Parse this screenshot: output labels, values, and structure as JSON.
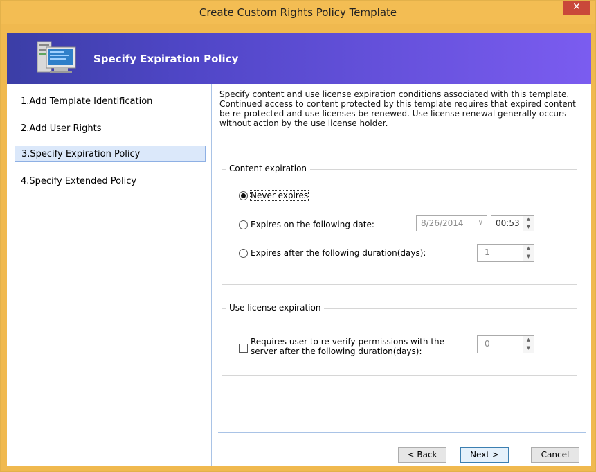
{
  "window": {
    "title": "Create Custom Rights Policy Template",
    "close_glyph": "✕"
  },
  "header": {
    "title": "Specify Expiration Policy",
    "icon": "computer-server-icon"
  },
  "steps": [
    {
      "label": "1.Add Template Identification"
    },
    {
      "label": "2.Add User Rights"
    },
    {
      "label": "3.Specify Expiration Policy"
    },
    {
      "label": "4.Specify Extended Policy"
    }
  ],
  "description": "Specify content and use license expiration conditions associated with this template. Continued access to content protected by this template requires that expired content be re-protected and use licenses be renewed. Use license renewal generally occurs without action by the use license holder.",
  "content_expiration": {
    "legend": "Content expiration",
    "never_label": "Never expires",
    "date_label": "Expires on the following date:",
    "date_value": "8/26/2014",
    "time_value": "00:53",
    "duration_label": "Expires after the following duration(days):",
    "duration_value": "1"
  },
  "use_license": {
    "legend": "Use license expiration",
    "reverify_label": "Requires user to re-verify permissions with the server after the following duration(days):",
    "reverify_value": "0"
  },
  "buttons": {
    "back": "< Back",
    "next": "Next >",
    "cancel": "Cancel"
  }
}
